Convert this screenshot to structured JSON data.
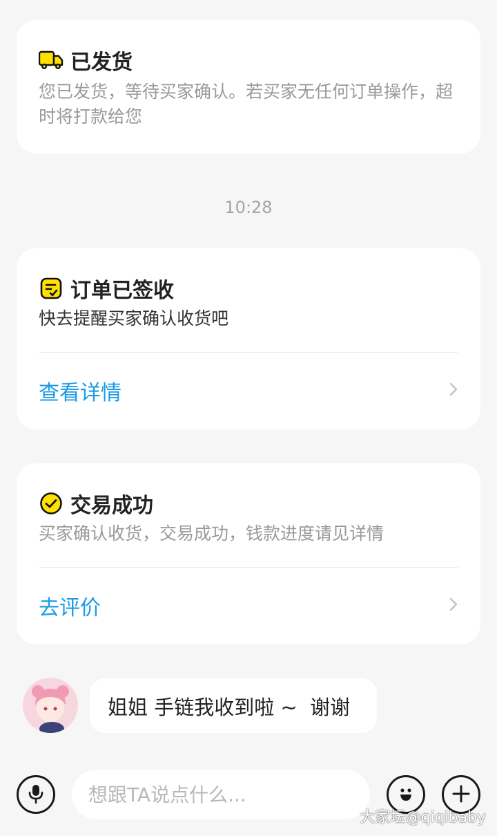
{
  "shipped_card": {
    "title": "已发货",
    "icon": "truck-icon",
    "description": "您已发货，等待买家确认。若买家无任何订单操作，超时将打款给您"
  },
  "timestamp": "10:28",
  "signed_card": {
    "title": "订单已签收",
    "icon": "receipt-icon",
    "description": "快去提醒买家确认收货吧",
    "link_label": "查看详情"
  },
  "success_card": {
    "title": "交易成功",
    "icon": "check-circle-icon",
    "description": "买家确认收货，交易成功，钱款进度请见详情",
    "link_label": "去评价"
  },
  "message": {
    "text": "姐姐 手链我收到啦 ~  谢谢"
  },
  "input_bar": {
    "placeholder": "想跟TA说点什么..."
  },
  "watermark": "大家坛@qiqibaby",
  "colors": {
    "accent_yellow": "#ffe100",
    "link_blue": "#1a9be6"
  }
}
